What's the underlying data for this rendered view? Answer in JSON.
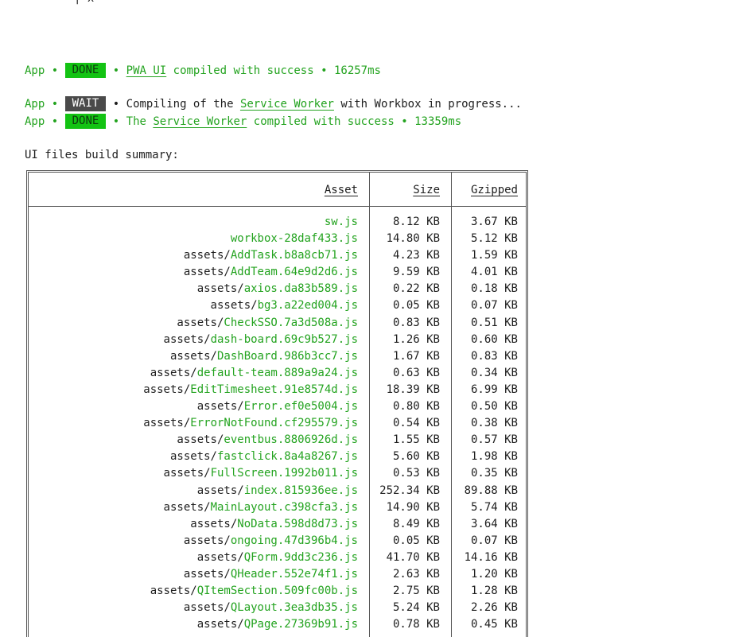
{
  "top_fragment": "| x",
  "log": {
    "line1": {
      "prefix": "App",
      "sep": "•",
      "status": "DONE",
      "link": "PWA UI",
      "rest": " compiled with success",
      "time": "16257ms"
    },
    "line2": {
      "prefix": "App",
      "sep": "•",
      "status": "WAIT",
      "pre": "Compiling of the ",
      "link": "Service Worker",
      "rest": " with Workbox in progress..."
    },
    "line3": {
      "prefix": "App",
      "sep": "•",
      "status": "DONE",
      "pre": "The ",
      "link": "Service Worker",
      "rest": " compiled with success",
      "time": "13359ms"
    }
  },
  "summary_title": "UI files build summary:",
  "table": {
    "headers": {
      "asset": "Asset",
      "size": "Size",
      "gzipped": "Gzipped"
    },
    "rows": [
      {
        "dir": "",
        "file": "sw.js",
        "size": "8.12 KB",
        "gz": "3.67 KB"
      },
      {
        "dir": "",
        "file": "workbox-28daf433.js",
        "size": "14.80 KB",
        "gz": "5.12 KB"
      },
      {
        "dir": "assets/",
        "file": "AddTask.b8a8cb71.js",
        "size": "4.23 KB",
        "gz": "1.59 KB"
      },
      {
        "dir": "assets/",
        "file": "AddTeam.64e9d2d6.js",
        "size": "9.59 KB",
        "gz": "4.01 KB"
      },
      {
        "dir": "assets/",
        "file": "axios.da83b589.js",
        "size": "0.22 KB",
        "gz": "0.18 KB"
      },
      {
        "dir": "assets/",
        "file": "bg3.a22ed004.js",
        "size": "0.05 KB",
        "gz": "0.07 KB"
      },
      {
        "dir": "assets/",
        "file": "CheckSSO.7a3d508a.js",
        "size": "0.83 KB",
        "gz": "0.51 KB"
      },
      {
        "dir": "assets/",
        "file": "dash-board.69c9b527.js",
        "size": "1.26 KB",
        "gz": "0.60 KB"
      },
      {
        "dir": "assets/",
        "file": "DashBoard.986b3cc7.js",
        "size": "1.67 KB",
        "gz": "0.83 KB"
      },
      {
        "dir": "assets/",
        "file": "default-team.889a9a24.js",
        "size": "0.63 KB",
        "gz": "0.34 KB"
      },
      {
        "dir": "assets/",
        "file": "EditTimesheet.91e8574d.js",
        "size": "18.39 KB",
        "gz": "6.99 KB"
      },
      {
        "dir": "assets/",
        "file": "Error.ef0e5004.js",
        "size": "0.80 KB",
        "gz": "0.50 KB"
      },
      {
        "dir": "assets/",
        "file": "ErrorNotFound.cf295579.js",
        "size": "0.54 KB",
        "gz": "0.38 KB"
      },
      {
        "dir": "assets/",
        "file": "eventbus.8806926d.js",
        "size": "1.55 KB",
        "gz": "0.57 KB"
      },
      {
        "dir": "assets/",
        "file": "fastclick.8a4a8267.js",
        "size": "5.60 KB",
        "gz": "1.98 KB"
      },
      {
        "dir": "assets/",
        "file": "FullScreen.1992b011.js",
        "size": "0.53 KB",
        "gz": "0.35 KB"
      },
      {
        "dir": "assets/",
        "file": "index.815936ee.js",
        "size": "252.34 KB",
        "gz": "89.88 KB"
      },
      {
        "dir": "assets/",
        "file": "MainLayout.c398cfa3.js",
        "size": "14.90 KB",
        "gz": "5.74 KB"
      },
      {
        "dir": "assets/",
        "file": "NoData.598d8d73.js",
        "size": "8.49 KB",
        "gz": "3.64 KB"
      },
      {
        "dir": "assets/",
        "file": "ongoing.47d396b4.js",
        "size": "0.05 KB",
        "gz": "0.07 KB"
      },
      {
        "dir": "assets/",
        "file": "QForm.9dd3c236.js",
        "size": "41.70 KB",
        "gz": "14.16 KB"
      },
      {
        "dir": "assets/",
        "file": "QHeader.552e74f1.js",
        "size": "2.63 KB",
        "gz": "1.20 KB"
      },
      {
        "dir": "assets/",
        "file": "QItemSection.509fc00b.js",
        "size": "2.75 KB",
        "gz": "1.28 KB"
      },
      {
        "dir": "assets/",
        "file": "QLayout.3ea3db35.js",
        "size": "5.24 KB",
        "gz": "2.26 KB"
      },
      {
        "dir": "assets/",
        "file": "QPage.27369b91.js",
        "size": "0.78 KB",
        "gz": "0.45 KB"
      }
    ]
  },
  "colors": {
    "green_text": "#23a31f",
    "done_badge": "#13c313",
    "wait_badge": "#4a4a4a"
  }
}
